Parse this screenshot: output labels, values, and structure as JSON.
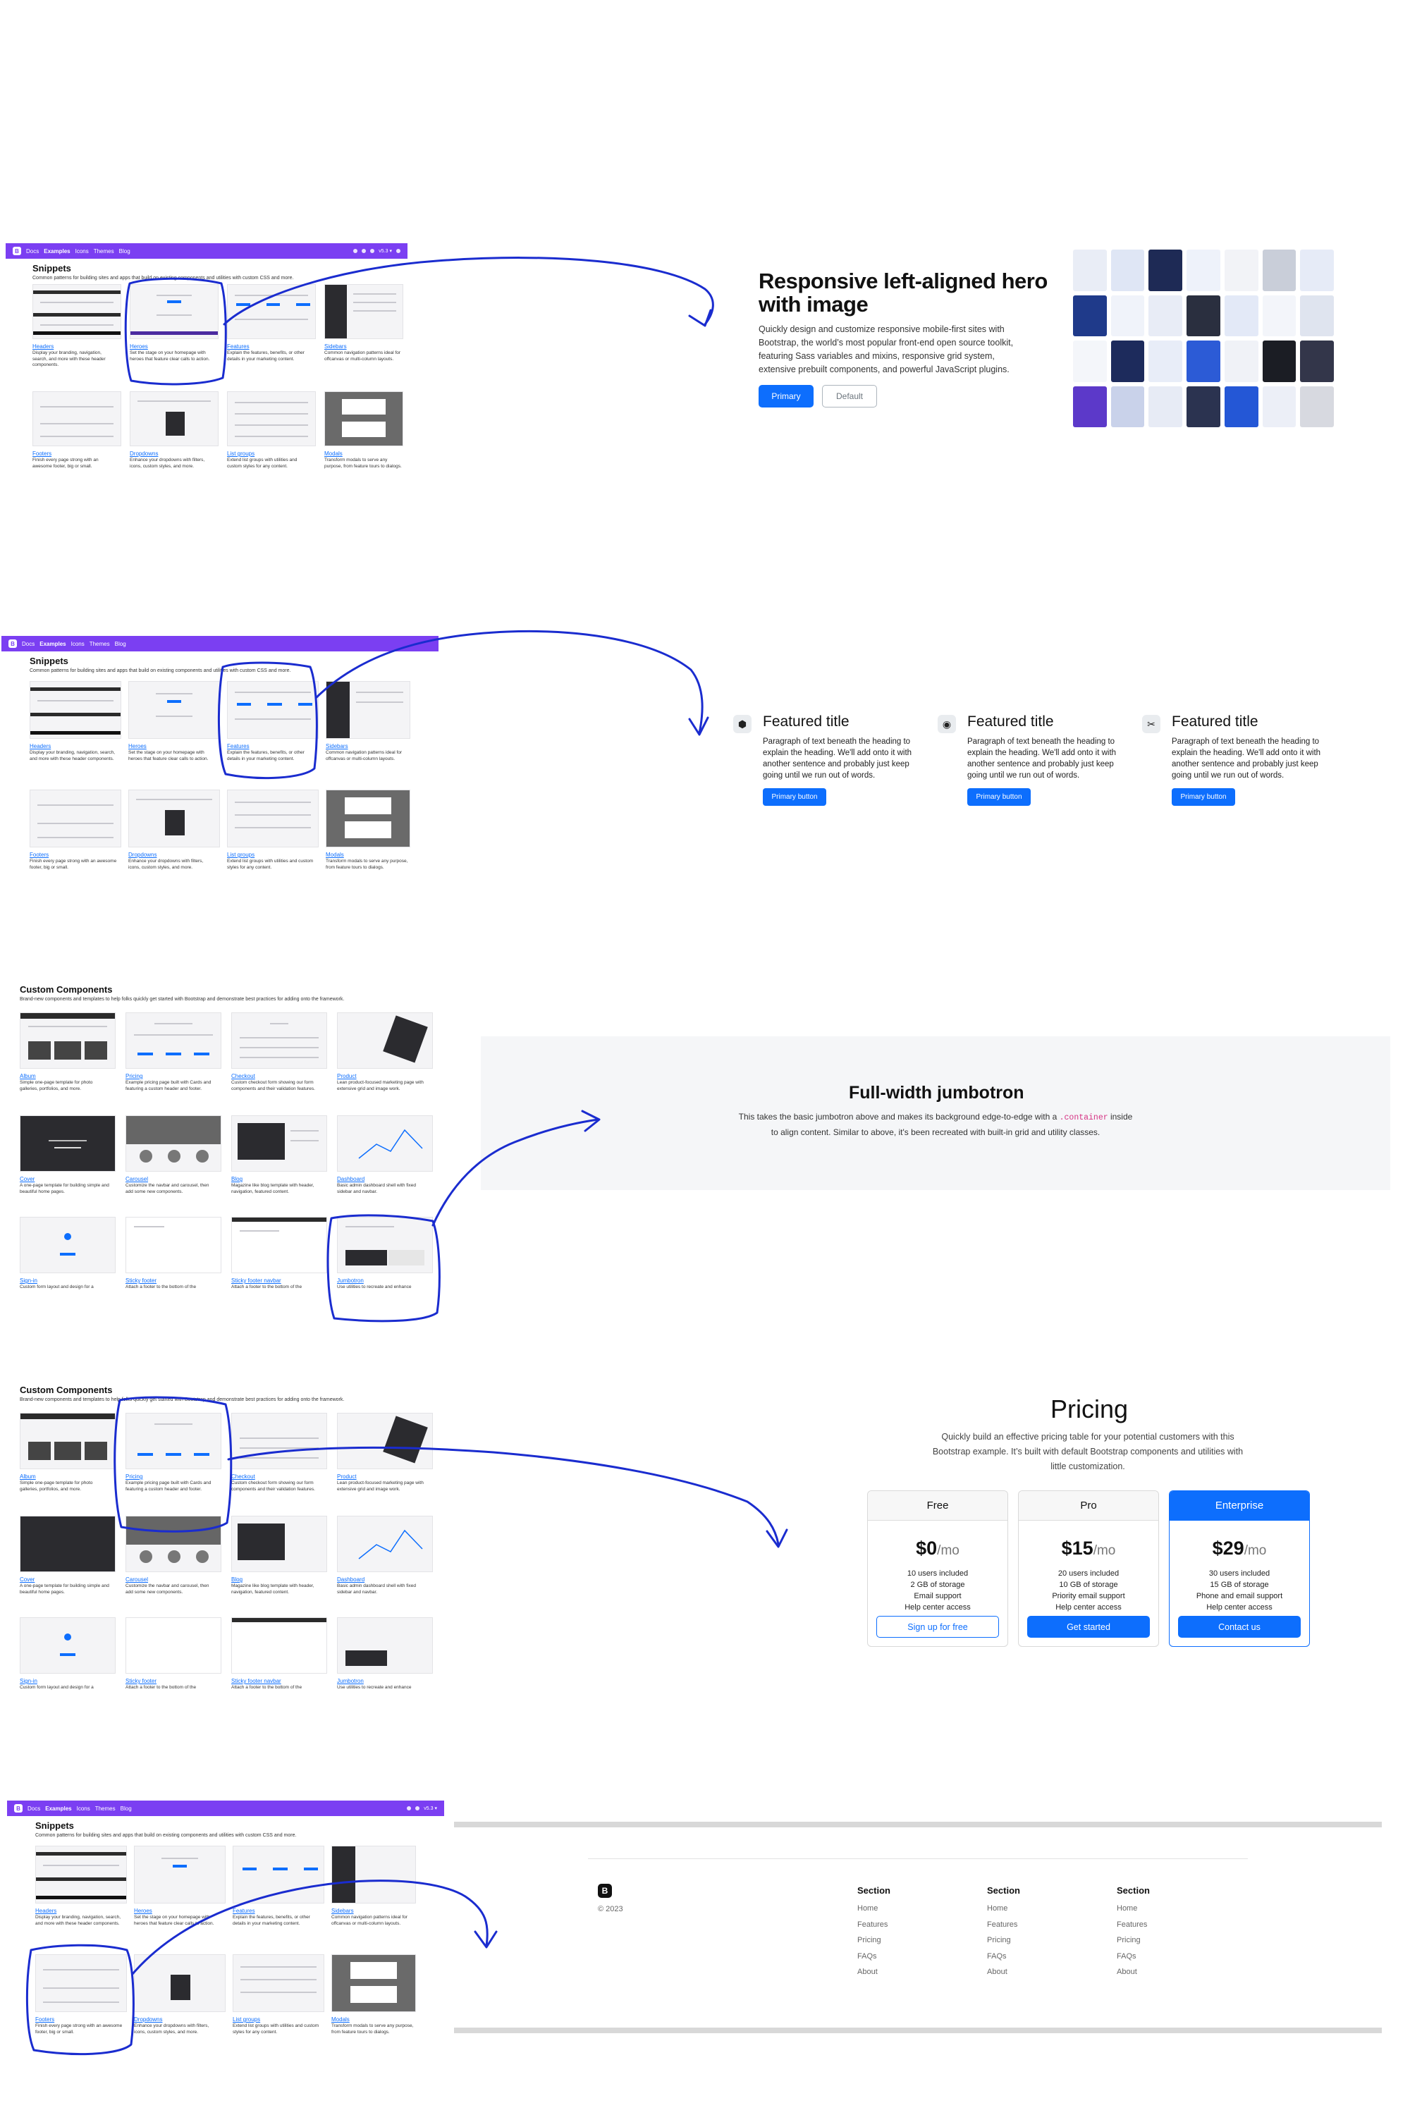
{
  "navbar": {
    "logo": "B",
    "links": [
      "Docs",
      "Examples",
      "Icons",
      "Themes",
      "Blog"
    ],
    "version": "v5.3 ▾"
  },
  "snippets": {
    "title": "Snippets",
    "subtitle": "Common patterns for building sites and apps that build on existing components and utilities with custom CSS and more.",
    "items": [
      {
        "name": "Headers",
        "desc": "Display your branding, navigation, search, and more with these header components."
      },
      {
        "name": "Heroes",
        "desc": "Set the stage on your homepage with heroes that feature clear calls to action."
      },
      {
        "name": "Features",
        "desc": "Explain the features, benefits, or other details in your marketing content."
      },
      {
        "name": "Sidebars",
        "desc": "Common navigation patterns ideal for offcanvas or multi-column layouts."
      },
      {
        "name": "Footers",
        "desc": "Finish every page strong with an awesome footer, big or small."
      },
      {
        "name": "Dropdowns",
        "desc": "Enhance your dropdowns with filters, icons, custom styles, and more."
      },
      {
        "name": "List groups",
        "desc": "Extend list groups with utilities and custom styles for any content."
      },
      {
        "name": "Modals",
        "desc": "Transform modals to serve any purpose, from feature tours to dialogs."
      }
    ]
  },
  "custom": {
    "title": "Custom Components",
    "subtitle": "Brand-new components and templates to help folks quickly get started with Bootstrap and demonstrate best practices for adding onto the framework.",
    "items": [
      {
        "name": "Album",
        "desc": "Simple one-page template for photo galleries, portfolios, and more."
      },
      {
        "name": "Pricing",
        "desc": "Example pricing page built with Cards and featuring a custom header and footer."
      },
      {
        "name": "Checkout",
        "desc": "Custom checkout form showing our form components and their validation features."
      },
      {
        "name": "Product",
        "desc": "Lean product-focused marketing page with extensive grid and image work."
      },
      {
        "name": "Cover",
        "desc": "A one-page template for building simple and beautiful home pages."
      },
      {
        "name": "Carousel",
        "desc": "Customize the navbar and carousel, then add some new components."
      },
      {
        "name": "Blog",
        "desc": "Magazine like blog template with header, navigation, featured content."
      },
      {
        "name": "Dashboard",
        "desc": "Basic admin dashboard shell with fixed sidebar and navbar."
      },
      {
        "name": "Sign-in",
        "desc": "Custom form layout and design for a"
      },
      {
        "name": "Sticky footer",
        "desc": "Attach a footer to the bottom of the"
      },
      {
        "name": "Sticky footer navbar",
        "desc": "Attach a footer to the bottom of the"
      },
      {
        "name": "Jumbotron",
        "desc": "Use utilities to recreate and enhance"
      }
    ]
  },
  "hero": {
    "title": "Responsive left-aligned hero with image",
    "text": "Quickly design and customize responsive mobile-first sites with Bootstrap, the world’s most popular front-end open source toolkit, featuring Sass variables and mixins, responsive grid system, extensive prebuilt components, and powerful JavaScript plugins.",
    "primary": "Primary",
    "default": "Default"
  },
  "features": {
    "items": [
      {
        "icon": "bootstrap-icon",
        "title": "Featured title",
        "text": "Paragraph of text beneath the heading to explain the heading. We'll add onto it with another sentence and probably just keep going until we run out of words.",
        "button": "Primary button"
      },
      {
        "icon": "cpu-icon",
        "title": "Featured title",
        "text": "Paragraph of text beneath the heading to explain the heading. We'll add onto it with another sentence and probably just keep going until we run out of words.",
        "button": "Primary button"
      },
      {
        "icon": "tools-icon",
        "title": "Featured title",
        "text": "Paragraph of text beneath the heading to explain the heading. We'll add onto it with another sentence and probably just keep going until we run out of words.",
        "button": "Primary button"
      }
    ]
  },
  "jumbotron": {
    "title": "Full-width jumbotron",
    "text_before": "This takes the basic jumbotron above and makes its background edge-to-edge with a ",
    "code": ".container",
    "text_after": " inside to align content. Similar to above, it's been recreated with built-in grid and utility classes."
  },
  "pricing": {
    "title": "Pricing",
    "text": "Quickly build an effective pricing table for your potential customers with this Bootstrap example. It’s built with default Bootstrap components and utilities with little customization.",
    "plans": [
      {
        "name": "Free",
        "price": "$0",
        "period": "/mo",
        "features": [
          "10 users included",
          "2 GB of storage",
          "Email support",
          "Help center access"
        ],
        "button": "Sign up for free"
      },
      {
        "name": "Pro",
        "price": "$15",
        "period": "/mo",
        "features": [
          "20 users included",
          "10 GB of storage",
          "Priority email support",
          "Help center access"
        ],
        "button": "Get started"
      },
      {
        "name": "Enterprise",
        "price": "$29",
        "period": "/mo",
        "features": [
          "30 users included",
          "15 GB of storage",
          "Phone and email support",
          "Help center access"
        ],
        "button": "Contact us"
      }
    ]
  },
  "footer": {
    "logo": "B",
    "copyright": "© 2023",
    "columns": [
      {
        "title": "Section",
        "links": [
          "Home",
          "Features",
          "Pricing",
          "FAQs",
          "About"
        ]
      },
      {
        "title": "Section",
        "links": [
          "Home",
          "Features",
          "Pricing",
          "FAQs",
          "About"
        ]
      },
      {
        "title": "Section",
        "links": [
          "Home",
          "Features",
          "Pricing",
          "FAQs",
          "About"
        ]
      }
    ]
  },
  "colors": {
    "navbar": "#7b3ff2",
    "primary": "#0d6efd",
    "annotation": "#1a2ccf"
  }
}
